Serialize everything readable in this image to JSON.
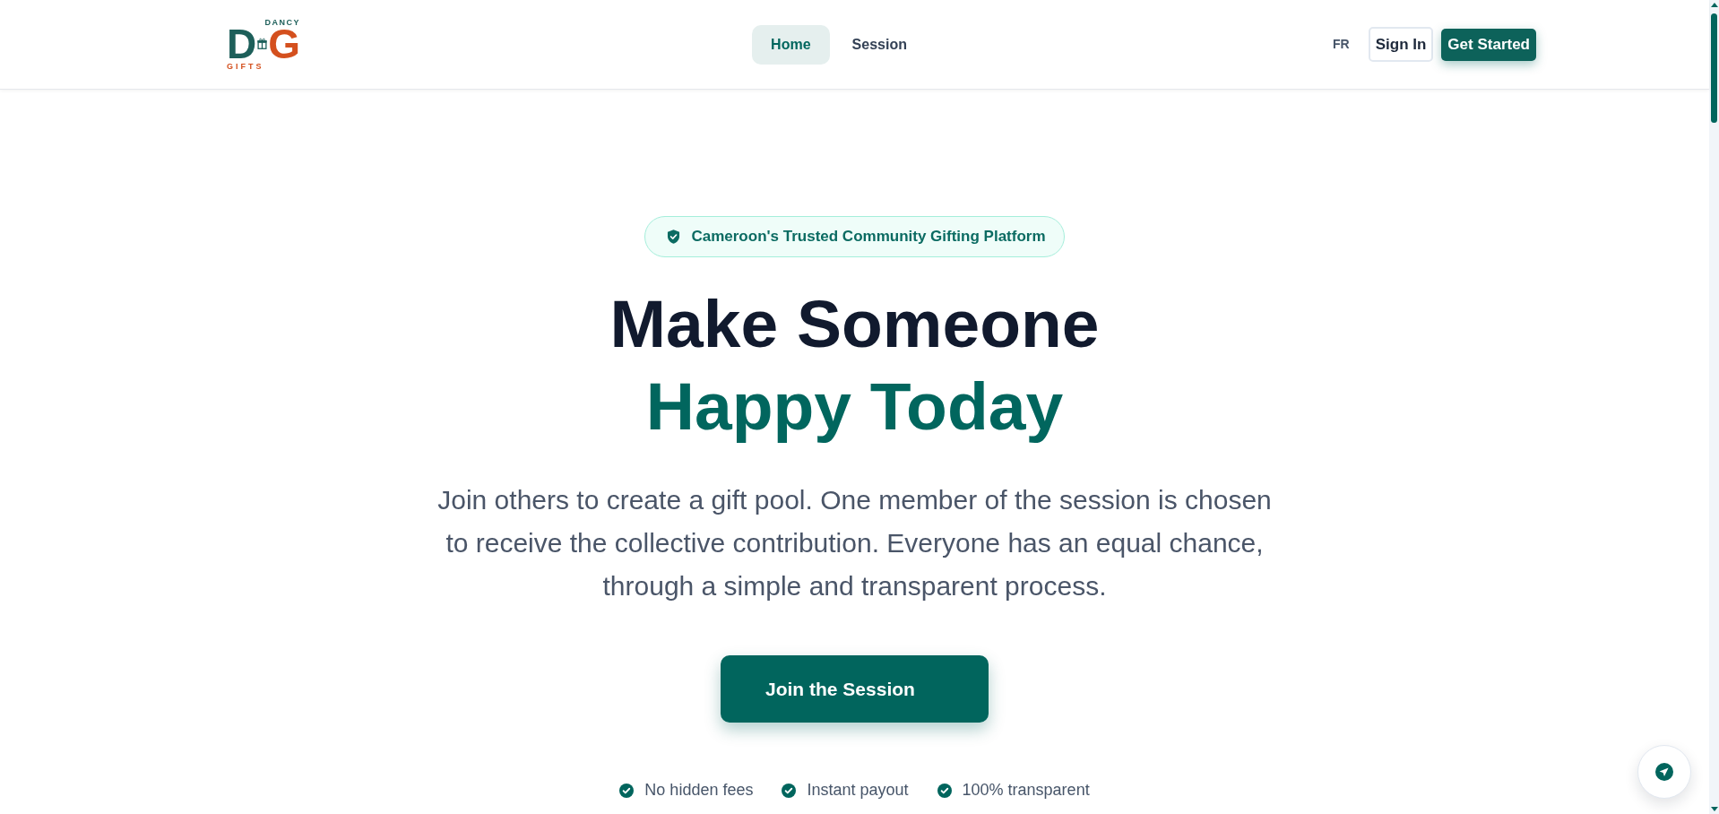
{
  "header": {
    "logo": {
      "top_text": "DANCY",
      "letter_1": "D",
      "letter_2": "G",
      "bottom_text": "GIFTS"
    },
    "nav": [
      {
        "label": "Home",
        "selected": true
      },
      {
        "label": "Session",
        "selected": false
      }
    ],
    "language": "FR",
    "sign_in": "Sign In",
    "get_started": "Get Started"
  },
  "hero": {
    "badge": "Cameroon's Trusted Community Gifting Platform",
    "title_line_1": "Make Someone",
    "title_line_2": "Happy Today",
    "description": "Join others to create a gift pool. One member of the session is chosen to receive the collective contribution. Everyone has an equal chance, through a simple and transparent process.",
    "cta": "Join the Session",
    "features": [
      "No hidden fees",
      "Instant payout",
      "100% transparent"
    ]
  }
}
